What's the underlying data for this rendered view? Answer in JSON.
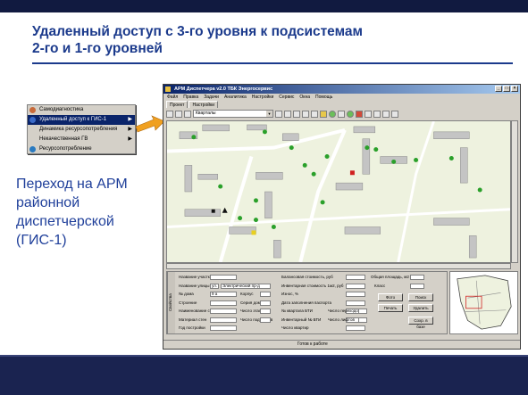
{
  "slide": {
    "title_line1": "Удаленный доступ с 3-го уровня к подсистемам",
    "title_line2": "2-го и 1-го уровней",
    "description": "Переход на АРМ районной диспетчерской (ГИС-1)"
  },
  "context_menu": {
    "items": [
      {
        "label": "Самодиагностика",
        "icon": "person-icon",
        "color": "#c86a3a",
        "submenu": false,
        "selected": false
      },
      {
        "label": "Удаленный доступ к ГИС-1",
        "icon": "user-icon",
        "color": "#3a6ac8",
        "submenu": true,
        "selected": true
      },
      {
        "label": "Динамика ресурсопотребления",
        "icon": "",
        "color": "",
        "submenu": true,
        "selected": false
      },
      {
        "label": "Некачественная ГВ",
        "icon": "",
        "color": "",
        "submenu": true,
        "selected": false
      },
      {
        "label": "Ресурсопотребление",
        "icon": "globe-icon",
        "color": "#2a7ac0",
        "submenu": false,
        "selected": false
      }
    ]
  },
  "app_window": {
    "title": "АРМ Диспетчера v2.0 ТБК Энергосервис",
    "menu": [
      "Файл",
      "Правка",
      "Задачи",
      "Аналитика",
      "Настройки",
      "Сервис",
      "Окна",
      "Помощь"
    ],
    "tabs": [
      "Проект",
      "Настройки"
    ],
    "layer_select": "Кварталы",
    "status_text": "Готов к работе",
    "form": {
      "side_tab": "Свойства",
      "fields_left": [
        {
          "label": "Название участка",
          "value": ""
        },
        {
          "label": "Название улицы",
          "value": "ул."
        },
        {
          "label": "№ дома",
          "value": "9 а"
        },
        {
          "label": "Строение",
          "value": ""
        },
        {
          "label": "Наименование стен",
          "value": ""
        },
        {
          "label": "Материал стен",
          "value": ""
        },
        {
          "label": "Год постройки",
          "value": ""
        }
      ],
      "street_value": "Электрический пр-д",
      "fields_mid": [
        {
          "label": "Корпус",
          "value": ""
        },
        {
          "label": "Серия дома",
          "value": ""
        },
        {
          "label": "Число этажей",
          "value": ""
        },
        {
          "label": "Число подъездов",
          "value": ""
        }
      ],
      "fields_right": [
        {
          "label": "Балансовая стоимость, руб",
          "value": ""
        },
        {
          "label": "Инвентарная стоимость 1м2, руб",
          "value": ""
        },
        {
          "label": "Износ, %",
          "value": ""
        },
        {
          "label": "Дата заполнения паспорта",
          "value": ""
        },
        {
          "label": "№ квартала БТИ",
          "value": ""
        },
        {
          "label": "Инвентарный № БТИ",
          "value": ""
        },
        {
          "label": "Число квартир",
          "value": ""
        }
      ],
      "area_label": "Общая площадь, м2",
      "class_label": "Класс",
      "extra_fields": [
        {
          "label": "Число переходов",
          "value": ""
        },
        {
          "label": "Число лифтов",
          "value": ""
        }
      ],
      "buttons": {
        "photo": "Фото",
        "search": "Поиск",
        "print": "Печать",
        "delete": "Удалить",
        "save": "Сохр. в базе"
      }
    }
  },
  "colors": {
    "title": "#1b3a8c",
    "description": "#1f3f9a",
    "top_bar": "#111a40",
    "bottom_bar": "#1a2350",
    "arrow": "#f0a020",
    "map_bg": "#eef2df",
    "building": "#c4c4c4",
    "marker_green": "#2aa02a",
    "marker_red": "#d02020",
    "marker_yellow": "#e8d020"
  }
}
